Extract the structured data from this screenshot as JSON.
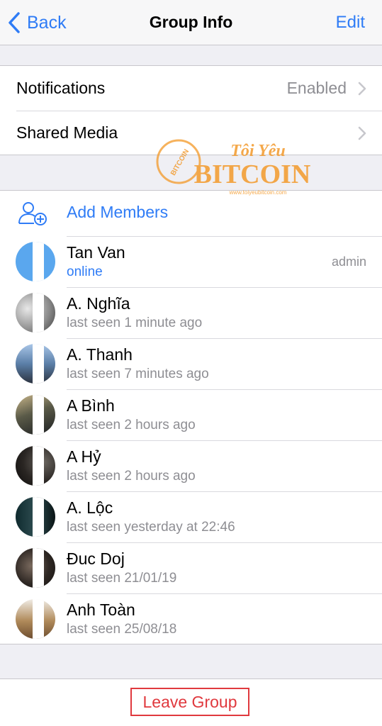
{
  "nav": {
    "back_label": "Back",
    "title": "Group Info",
    "edit_label": "Edit"
  },
  "settings": {
    "notifications": {
      "label": "Notifications",
      "value": "Enabled"
    },
    "shared_media": {
      "label": "Shared Media"
    }
  },
  "add_members": {
    "label": "Add Members"
  },
  "members": [
    {
      "name": "Tan Van",
      "status": "online",
      "role": "admin"
    },
    {
      "name": "A. Nghĩa",
      "status": "last seen 1 minute ago"
    },
    {
      "name": "A. Thanh",
      "status": "last seen 7 minutes ago"
    },
    {
      "name": "A Bình",
      "status": "last seen 2 hours ago"
    },
    {
      "name": "A Hỷ",
      "status": "last seen 2 hours ago"
    },
    {
      "name": "A. Lộc",
      "status": "last seen yesterday at 22:46"
    },
    {
      "name": "Đuc Doj",
      "status": "last seen 21/01/19"
    },
    {
      "name": "Anh Toàn",
      "status": "last seen 25/08/18"
    }
  ],
  "leave": {
    "label": "Leave Group"
  },
  "watermark": {
    "brand_top": "Tôi Yêu",
    "brand_main": "BITCOIN",
    "site": "www.toiyeubitcoin.com",
    "badge": "BITCOIN"
  },
  "colors": {
    "accent": "#2f7cf6",
    "danger": "#e0393e",
    "secondary_text": "#8e8e93",
    "background": "#efeff4",
    "watermark": "#f39a2b"
  }
}
